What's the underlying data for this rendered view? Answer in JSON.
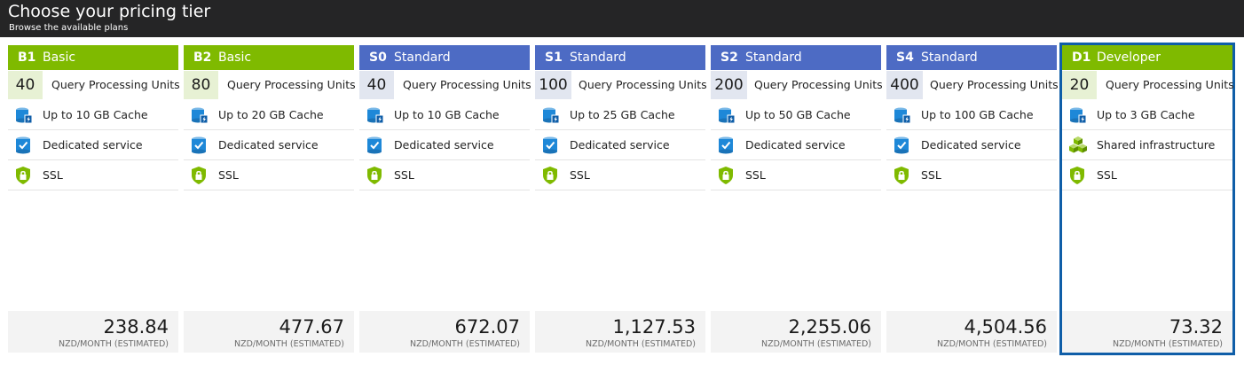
{
  "header": {
    "title": "Choose your pricing tier",
    "subtitle": "Browse the available plans"
  },
  "colors": {
    "basic_header": "#7fba00",
    "standard_header": "#4d6bc4",
    "developer_header": "#7fba00",
    "selected_border": "#0f5ea8"
  },
  "tiers": [
    {
      "code": "B1",
      "name": "Basic",
      "units": "40",
      "units_label": "Query Processing Units",
      "cache": "Up to 10 GB Cache",
      "service": "Dedicated service",
      "ssl": "SSL",
      "price": "238.84",
      "price_unit": "NZD/MONTH (ESTIMATED)"
    },
    {
      "code": "B2",
      "name": "Basic",
      "units": "80",
      "units_label": "Query Processing Units",
      "cache": "Up to 20 GB Cache",
      "service": "Dedicated service",
      "ssl": "SSL",
      "price": "477.67",
      "price_unit": "NZD/MONTH (ESTIMATED)"
    },
    {
      "code": "S0",
      "name": "Standard",
      "units": "40",
      "units_label": "Query Processing Units",
      "cache": "Up to 10 GB Cache",
      "service": "Dedicated service",
      "ssl": "SSL",
      "price": "672.07",
      "price_unit": "NZD/MONTH (ESTIMATED)"
    },
    {
      "code": "S1",
      "name": "Standard",
      "units": "100",
      "units_label": "Query Processing Units",
      "cache": "Up to 25 GB Cache",
      "service": "Dedicated service",
      "ssl": "SSL",
      "price": "1,127.53",
      "price_unit": "NZD/MONTH (ESTIMATED)"
    },
    {
      "code": "S2",
      "name": "Standard",
      "units": "200",
      "units_label": "Query Processing Units",
      "cache": "Up to 50 GB Cache",
      "service": "Dedicated service",
      "ssl": "SSL",
      "price": "2,255.06",
      "price_unit": "NZD/MONTH (ESTIMATED)"
    },
    {
      "code": "S4",
      "name": "Standard",
      "units": "400",
      "units_label": "Query Processing Units",
      "cache": "Up to 100 GB Cache",
      "service": "Dedicated service",
      "ssl": "SSL",
      "price": "4,504.56",
      "price_unit": "NZD/MONTH (ESTIMATED)"
    },
    {
      "code": "D1",
      "name": "Developer",
      "units": "20",
      "units_label": "Query Processing Units",
      "cache": "Up to 3 GB Cache",
      "service": "Shared infrastructure",
      "ssl": "SSL",
      "price": "73.32",
      "price_unit": "NZD/MONTH (ESTIMATED)"
    }
  ],
  "icons": {
    "cache": "cache-database-icon",
    "dedicated": "dedicated-service-icon",
    "shared": "shared-infrastructure-icon",
    "ssl": "ssl-shield-icon"
  }
}
